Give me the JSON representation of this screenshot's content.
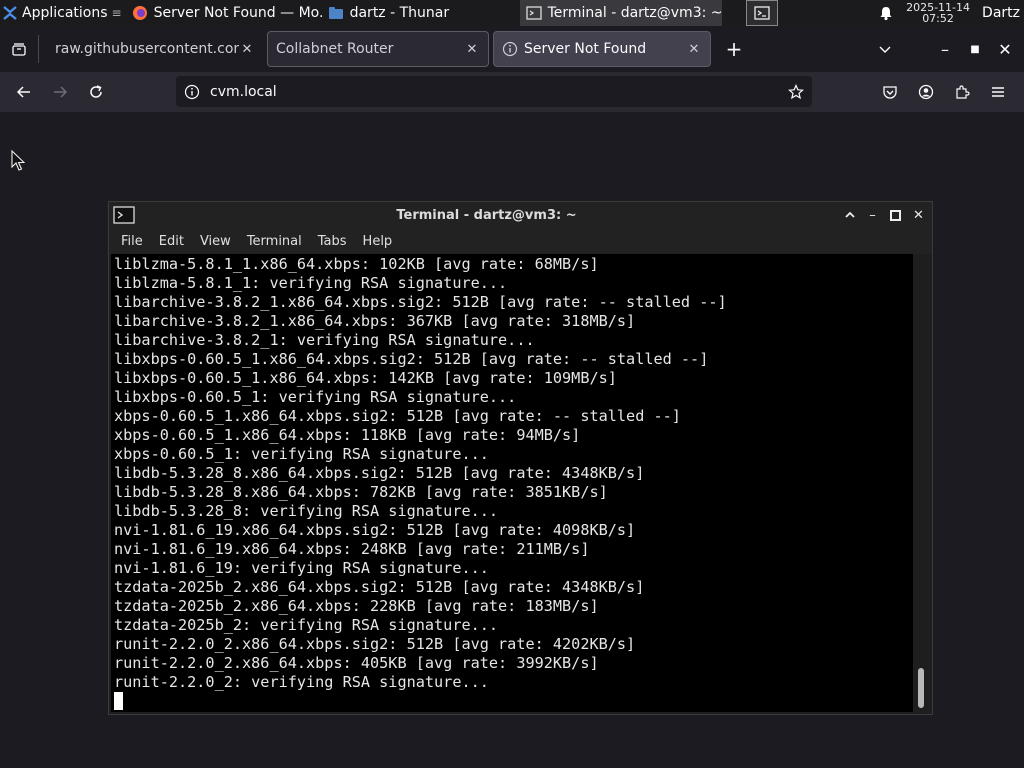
{
  "panel": {
    "applications": "Applications",
    "tasks": [
      {
        "label": "Server Not Found — Mo...",
        "icon": "firefox-icon"
      },
      {
        "label": "dartz - Thunar",
        "icon": "folder-icon"
      },
      {
        "label": "Terminal - dartz@vm3: ~",
        "icon": "terminal-icon"
      }
    ],
    "date": "2025-11-14",
    "time": "07:52",
    "user": "Dartz"
  },
  "browser": {
    "tabs": [
      {
        "label": "raw.githubusercontent.com/"
      },
      {
        "label": "Collabnet Router"
      },
      {
        "label": "Server Not Found"
      }
    ],
    "url": "cvm.local"
  },
  "terminal": {
    "title": "Terminal - dartz@vm3: ~",
    "menu": [
      "File",
      "Edit",
      "View",
      "Terminal",
      "Tabs",
      "Help"
    ],
    "lines": [
      "liblzma-5.8.1_1.x86_64.xbps: 102KB [avg rate: 68MB/s]",
      "liblzma-5.8.1_1: verifying RSA signature...",
      "libarchive-3.8.2_1.x86_64.xbps.sig2: 512B [avg rate: -- stalled --]",
      "libarchive-3.8.2_1.x86_64.xbps: 367KB [avg rate: 318MB/s]",
      "libarchive-3.8.2_1: verifying RSA signature...",
      "libxbps-0.60.5_1.x86_64.xbps.sig2: 512B [avg rate: -- stalled --]",
      "libxbps-0.60.5_1.x86_64.xbps: 142KB [avg rate: 109MB/s]",
      "libxbps-0.60.5_1: verifying RSA signature...",
      "xbps-0.60.5_1.x86_64.xbps.sig2: 512B [avg rate: -- stalled --]",
      "xbps-0.60.5_1.x86_64.xbps: 118KB [avg rate: 94MB/s]",
      "xbps-0.60.5_1: verifying RSA signature...",
      "libdb-5.3.28_8.x86_64.xbps.sig2: 512B [avg rate: 4348KB/s]",
      "libdb-5.3.28_8.x86_64.xbps: 782KB [avg rate: 3851KB/s]",
      "libdb-5.3.28_8: verifying RSA signature...",
      "nvi-1.81.6_19.x86_64.xbps.sig2: 512B [avg rate: 4098KB/s]",
      "nvi-1.81.6_19.x86_64.xbps: 248KB [avg rate: 211MB/s]",
      "nvi-1.81.6_19: verifying RSA signature...",
      "tzdata-2025b_2.x86_64.xbps.sig2: 512B [avg rate: 4348KB/s]",
      "tzdata-2025b_2.x86_64.xbps: 228KB [avg rate: 183MB/s]",
      "tzdata-2025b_2: verifying RSA signature...",
      "runit-2.2.0_2.x86_64.xbps.sig2: 512B [avg rate: 4202KB/s]",
      "runit-2.2.0_2.x86_64.xbps: 405KB [avg rate: 3992KB/s]",
      "runit-2.2.0_2: verifying RSA signature..."
    ]
  }
}
